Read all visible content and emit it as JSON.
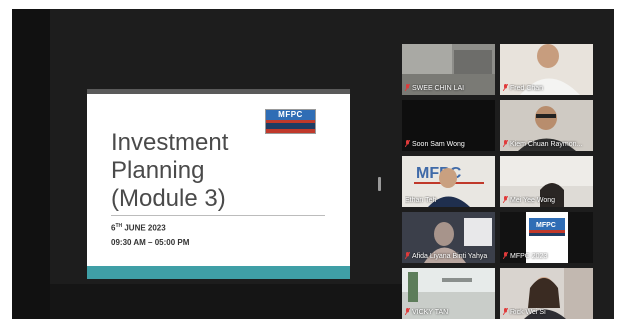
{
  "shared_screen": {
    "logo_text": "MFPC",
    "title_line1": "Investment",
    "title_line2": "Planning",
    "title_line3": "(Module 3)",
    "date_day": "6",
    "date_suffix": "TH",
    "date_rest": " JUNE 2023",
    "time": "09:30 AM – 05:00 PM"
  },
  "participants": [
    {
      "name": "SWEE CHIN LAI",
      "muted": true
    },
    {
      "name": "Fred Chan",
      "muted": true
    },
    {
      "name": "Soon Sam Wong",
      "muted": true
    },
    {
      "name": "Kiem Chuan Raymon...",
      "muted": true
    },
    {
      "name": "Ethan Teh",
      "muted": false,
      "active_speaker": true
    },
    {
      "name": "Mei Yee Wong",
      "muted": true
    },
    {
      "name": "Afida Liyana Binti Yahya",
      "muted": true
    },
    {
      "name": "MFPC 2023",
      "muted": true
    },
    {
      "name": "VICKY TAN",
      "muted": true
    },
    {
      "name": "Rick Wei Si",
      "muted": true
    }
  ],
  "colors": {
    "active_speaker_border": "#b8d96a",
    "mic_muted": "#e03a3a",
    "slide_accent": "#3f9fa6"
  }
}
